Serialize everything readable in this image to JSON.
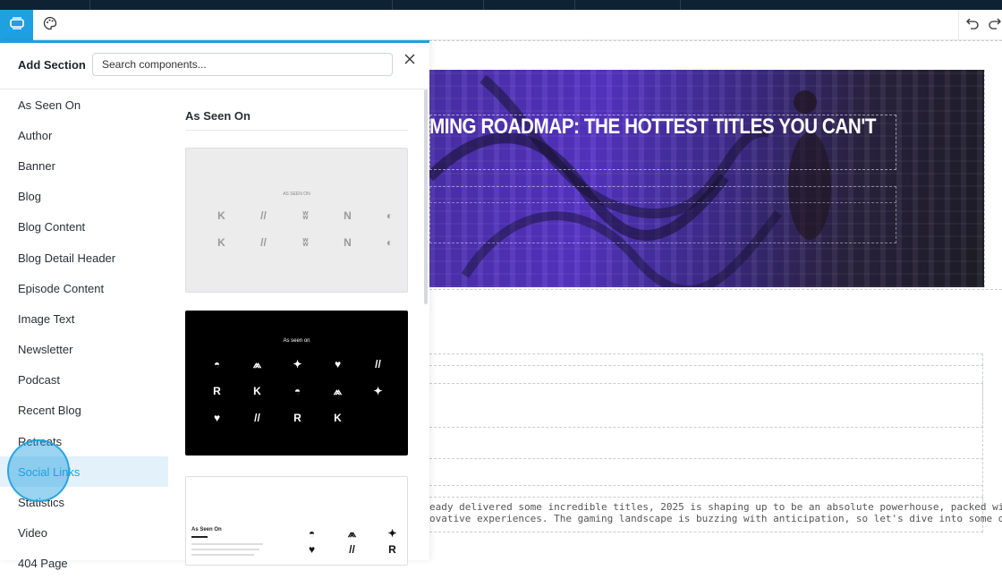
{
  "toolbar": {
    "sections_icon": "sections-icon",
    "theme_icon": "palette-icon",
    "undo_icon": "undo-icon",
    "redo_icon": "redo-icon"
  },
  "panel": {
    "title": "Add Section",
    "search_placeholder": "Search components...",
    "close_icon": "close-icon",
    "categories": [
      "As Seen On",
      "Author",
      "Banner",
      "Blog",
      "Blog Content",
      "Blog Detail Header",
      "Episode Content",
      "Image Text",
      "Newsletter",
      "Podcast",
      "Recent Blog",
      "Retreats",
      "Social Links",
      "Statistics",
      "Video",
      "404 Page"
    ],
    "selected_category": "Social Links",
    "section_heading": "As Seen On",
    "thumbnails": [
      {
        "caption": "AS SEEN ON"
      },
      {
        "caption": "As seen on"
      },
      {
        "caption": "As Seen On"
      }
    ]
  },
  "canvas": {
    "hero_title": "MING ROADMAP: THE HOTTEST TITLES YOU CAN'T",
    "body_line_1": "eady delivered some incredible titles, 2025 is shaping up to be an absolute powerhouse, packed with a perfect",
    "body_line_2": "ovative experiences. The gaming landscape is buzzing with anticipation, so let's dive into some of the hottest"
  },
  "colors": {
    "accent": "#1fa0e0",
    "topbar": "#0f2233",
    "hero_purple": "#5534c4"
  }
}
